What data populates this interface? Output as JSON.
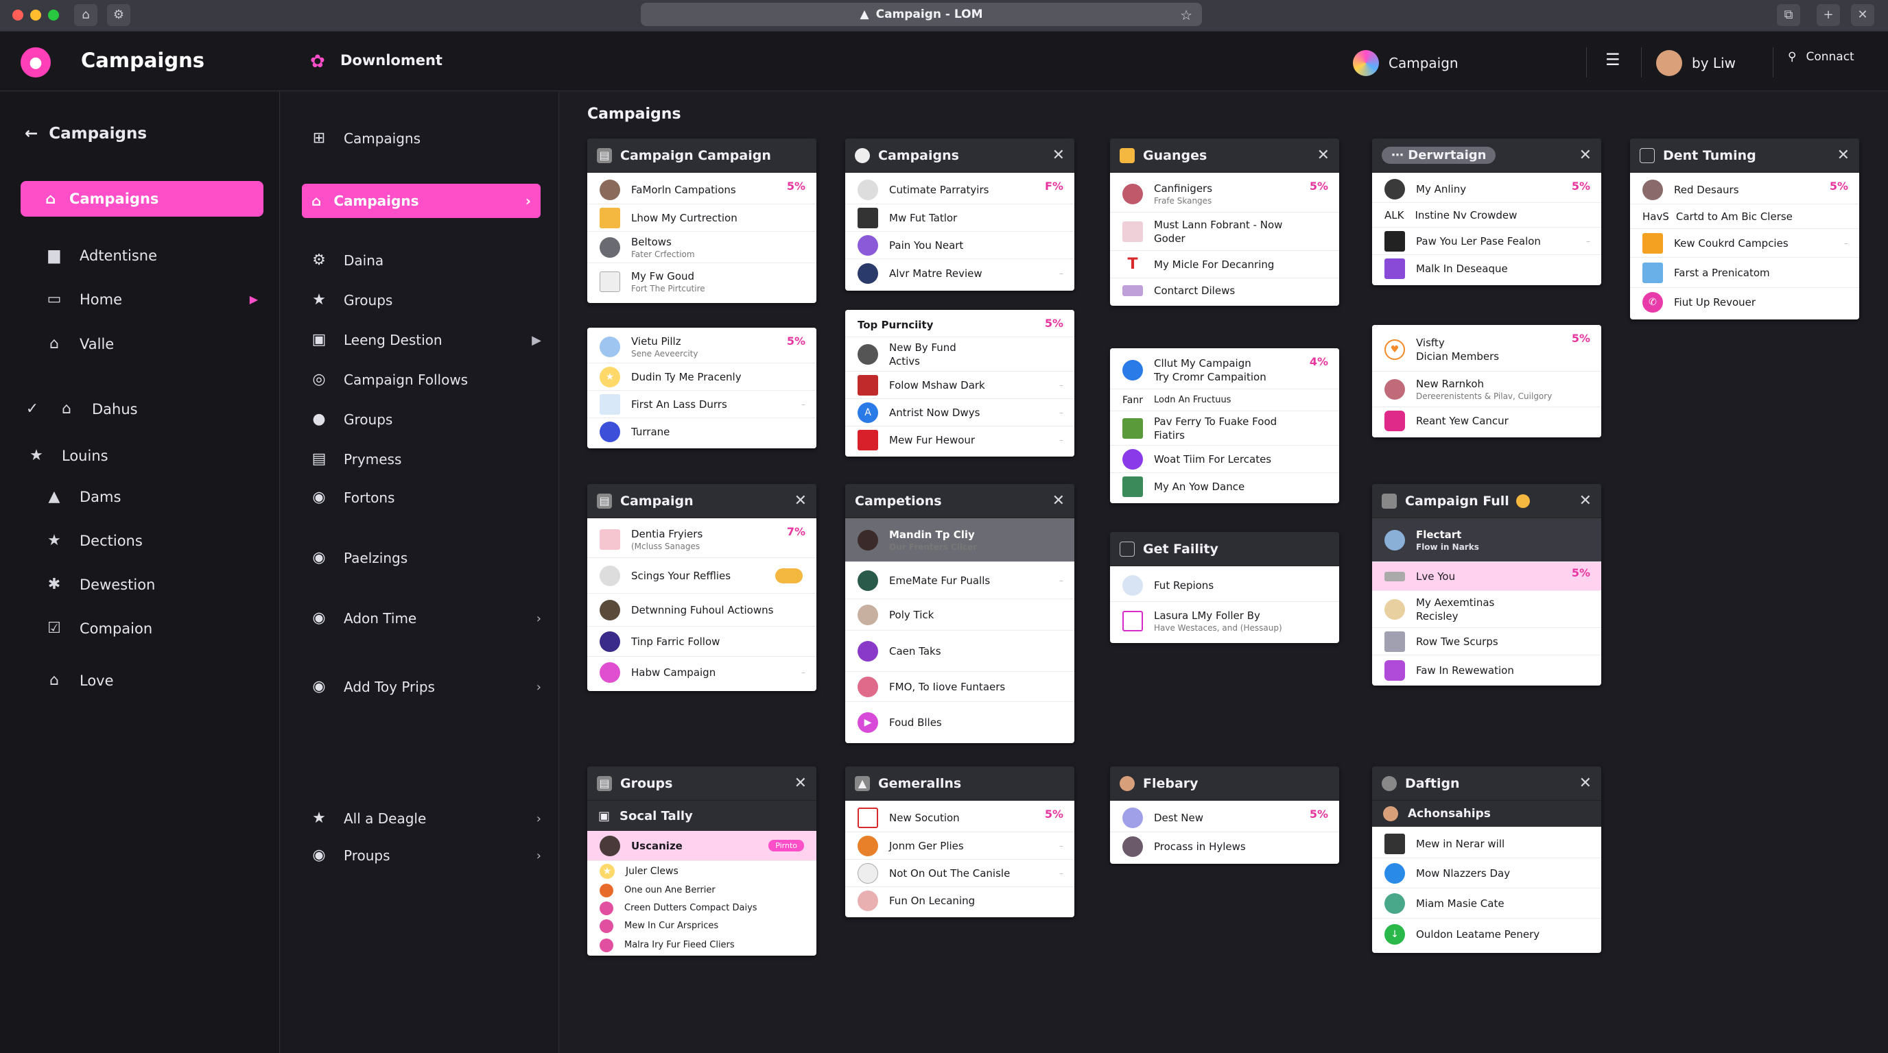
{
  "browser": {
    "tab_title": "Campaign - LOM"
  },
  "topbar": {
    "brand": "Campaigns",
    "section": "Downloment",
    "app": "Campaign",
    "user": "by Liw",
    "connect": "Connact"
  },
  "sidebar1": {
    "back": "Campaigns",
    "active": "Campaigns",
    "items": [
      "Adtentisne",
      "Home",
      "Valle",
      "Dahus",
      "Louins",
      "Dams",
      "Dections",
      "Dewestion",
      "Compaion",
      "Love"
    ]
  },
  "sidebar2": {
    "items": [
      "Campaigns",
      "Campaigns",
      "Daina",
      "Groups",
      "Leeng Destion",
      "Campaign Follows",
      "Groups",
      "Prymess",
      "Fortons",
      "Paelzings",
      "Adon Time",
      "Add Toy Prips",
      "All a Deagle",
      "Proups"
    ]
  },
  "main": {
    "title": "Campaigns"
  },
  "cards": {
    "c1": {
      "title": "Campaign Campaign",
      "rows": [
        {
          "t": "FaMorln Campations",
          "p": "5%"
        },
        {
          "t": "Lhow My Curtrection"
        },
        {
          "t": "Beltows",
          "s": "Fater Crfectiom"
        },
        {
          "t": "My Fw Goud",
          "s": "Fort The Pirtcutire"
        }
      ]
    },
    "c2": {
      "rows": [
        {
          "t": "Vietu Pillz",
          "s": "Sene Aeveercity",
          "p": "5%"
        },
        {
          "t": "Dudin Ty Me Pracenly"
        },
        {
          "t": "First An Lass Durrs"
        },
        {
          "t": "Turrane"
        }
      ]
    },
    "c3": {
      "title": "Campaign",
      "rows": [
        {
          "t": "Dentia Fryiers",
          "s": "(Mcluss Sanages",
          "p": "7%"
        },
        {
          "t": "Scings Your Refflies"
        },
        {
          "t": "Detwnning Fuhoul Actiowns"
        },
        {
          "t": "Tinp Farric Follow"
        },
        {
          "t": "Habw Campaign"
        }
      ]
    },
    "c4": {
      "title": "Groups",
      "sub": "Socal Tally",
      "rows": [
        {
          "t": "Uscanize",
          "b": "Pirnto"
        },
        {
          "t": "Juler Clews"
        },
        {
          "t": "One oun Ane Berrier"
        },
        {
          "t": "Creen Dutters Compact Daiys"
        },
        {
          "t": "Mew In Cur Arsprices"
        },
        {
          "t": "Malra Iry Fur Fieed Cliers"
        }
      ]
    },
    "c5": {
      "title": "Campaigns",
      "rows": [
        {
          "t": "Cutimate Parratyirs",
          "p": "F%"
        },
        {
          "t": "Mw Fut Tatlor"
        },
        {
          "t": "Pain You Neart"
        },
        {
          "t": "Alvr Matre Review"
        }
      ]
    },
    "c6": {
      "rows": [
        {
          "t": "Top Purnciity",
          "p": "5%"
        },
        {
          "t": "New By Fund",
          "s": "Activs"
        },
        {
          "t": "Folow Mshaw Dark"
        },
        {
          "t": "Antrist Now Dwys"
        },
        {
          "t": "Mew Fur Hewour"
        }
      ]
    },
    "c7": {
      "title": "Campetions",
      "rows": [
        {
          "t": "Mandin Tp Cliy",
          "s": "Our Frenters Cllcer"
        },
        {
          "t": "EmeMate Fur Pualls"
        },
        {
          "t": "Poly Tick"
        },
        {
          "t": "Caen Taks"
        },
        {
          "t": "FMO, To Iiove Funtaers"
        },
        {
          "t": "Foud Blles"
        }
      ]
    },
    "c8": {
      "title": "Gemerallns",
      "rows": [
        {
          "t": "New Socution",
          "p": "5%"
        },
        {
          "t": "Jonm Ger Plies"
        },
        {
          "t": "Not On Out The Canisle"
        },
        {
          "t": "Fun On Lecaning"
        }
      ]
    },
    "c9": {
      "title": "Guanges",
      "rows": [
        {
          "t": "Canfinigers",
          "s": "Frafe Skanges",
          "p": "5%"
        },
        {
          "t": "Must Lann Fobrant - Now",
          "s": "Goder"
        },
        {
          "t": "My Micle For Decanring"
        },
        {
          "t": "Contarct Dilews"
        }
      ]
    },
    "c10": {
      "rows": [
        {
          "t": "Cllut My Campaign",
          "s": "Try Cromr Campaition",
          "p": "4%"
        },
        {
          "t": "Lodn An Fructuus",
          "pre": "Fanr"
        },
        {
          "t": "Pav Ferry To Fuake Food",
          "s": "Fiatirs"
        },
        {
          "t": "Woat Tiim For Lercates"
        },
        {
          "t": "My An Yow Dance"
        }
      ]
    },
    "c11": {
      "title": "Get Faility",
      "rows": [
        {
          "t": "Fut Repions"
        },
        {
          "t": "Lasura LMy Foller By",
          "s": "Have Westaces, and (Hessaup)"
        }
      ]
    },
    "c12": {
      "title": "Flebary",
      "rows": [
        {
          "t": "Dest New",
          "p": "5%"
        },
        {
          "t": "Procass in Hylews"
        }
      ]
    },
    "c13": {
      "title": "Derwrtaign",
      "rows": [
        {
          "t": "My Anliny",
          "p": "5%"
        },
        {
          "t": "Instine Nv Crowdew",
          "pre": "ALK"
        },
        {
          "t": "Paw You Ler Pase Fealon"
        },
        {
          "t": "Malk In Deseaque"
        }
      ]
    },
    "c14": {
      "rows": [
        {
          "t": "Visfty",
          "s2": "Dician Members",
          "p": "5%"
        },
        {
          "t": "New Rarnkoh",
          "s": "Dereerenistents & Pilav, Cuilgory"
        },
        {
          "t": "Reant Yew Cancur"
        }
      ]
    },
    "c15": {
      "title": "Campaign Full",
      "rows": [
        {
          "t": "Flectart",
          "s": "Flow in Narks"
        },
        {
          "t": "Lve You",
          "p": "5%"
        },
        {
          "t": "My Aexemtinas",
          "s": "Recisley"
        },
        {
          "t": "Row Twe Scurps"
        },
        {
          "t": "Faw In Rewewation"
        }
      ]
    },
    "c16": {
      "title": "Daftign",
      "sub": "Achonsahips",
      "rows": [
        {
          "t": "Mew in Nerar will"
        },
        {
          "t": "Mow Nlazzers Day"
        },
        {
          "t": "Miam Masie Cate"
        },
        {
          "t": "Ouldon Leatame Penery"
        }
      ]
    },
    "c17": {
      "title": "Dent Tuming",
      "rows": [
        {
          "t": "Red Desaurs",
          "p": "5%"
        },
        {
          "t": "Cartd to Am Bic Clerse",
          "pre": "HavS"
        },
        {
          "t": "Kew Coukrd Campcies"
        },
        {
          "t": "Farst a Prenicatom"
        },
        {
          "t": "Fiut Up Revouer"
        }
      ]
    }
  },
  "colors": {
    "accent": "#ff4fc8",
    "sidebar_bg": "#16161b",
    "card_header": "#2d2d34"
  }
}
